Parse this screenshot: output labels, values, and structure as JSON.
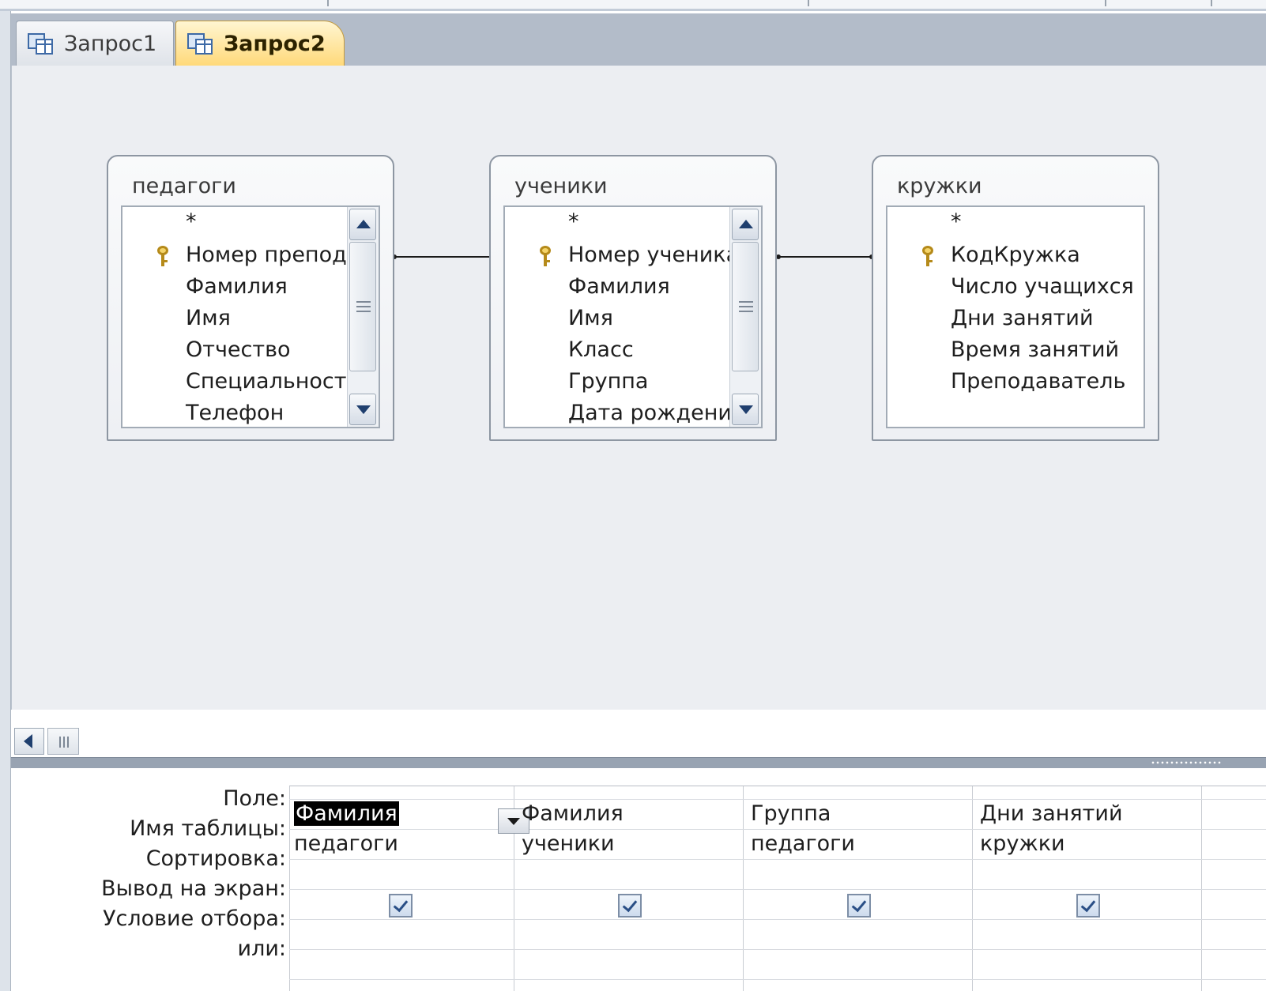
{
  "tabs": [
    {
      "label": "Запрос1",
      "active": false
    },
    {
      "label": "Запрос2",
      "active": true
    }
  ],
  "tables": [
    {
      "title": "педагоги",
      "star": "*",
      "fields": [
        "Номер препод",
        "Фамилия",
        "Имя",
        "Отчество",
        "Специальность",
        "Телефон"
      ],
      "key_field_index": 0,
      "has_scrollbar": true
    },
    {
      "title": "ученики",
      "star": "*",
      "fields": [
        "Номер ученика",
        "Фамилия",
        "Имя",
        "Класс",
        "Группа",
        "Дата рождения"
      ],
      "key_field_index": 0,
      "has_scrollbar": true
    },
    {
      "title": "кружки",
      "star": "*",
      "fields": [
        "КодКружка",
        "Число учащихся",
        "Дни занятий",
        "Время занятий",
        "Преподаватель"
      ],
      "key_field_index": 0,
      "has_scrollbar": false
    }
  ],
  "qbe": {
    "row_labels": {
      "field": "Поле:",
      "table": "Имя таблицы:",
      "sort": "Сортировка:",
      "show": "Вывод на экран:",
      "criteria": "Условие отбора:",
      "or": "или:"
    },
    "columns": [
      {
        "field": "Фамилия",
        "table": "педагоги",
        "sort": "",
        "show": true,
        "criteria": "",
        "or": ""
      },
      {
        "field": "Фамилия",
        "table": "ученики",
        "sort": "",
        "show": true,
        "criteria": "",
        "or": ""
      },
      {
        "field": "Группа",
        "table": "педагоги",
        "sort": "",
        "show": true,
        "criteria": "",
        "or": ""
      },
      {
        "field": "Дни занятий",
        "table": "кружки",
        "sort": "",
        "show": true,
        "criteria": "",
        "or": ""
      }
    ]
  },
  "colors": {
    "active_tab": "#ffd97a",
    "design_background": "#eceef2",
    "splitter": "#98a3b2",
    "key_icon": "#f4d46a"
  },
  "icons": {
    "tab": "query-icon",
    "primary_key": "key-icon"
  }
}
